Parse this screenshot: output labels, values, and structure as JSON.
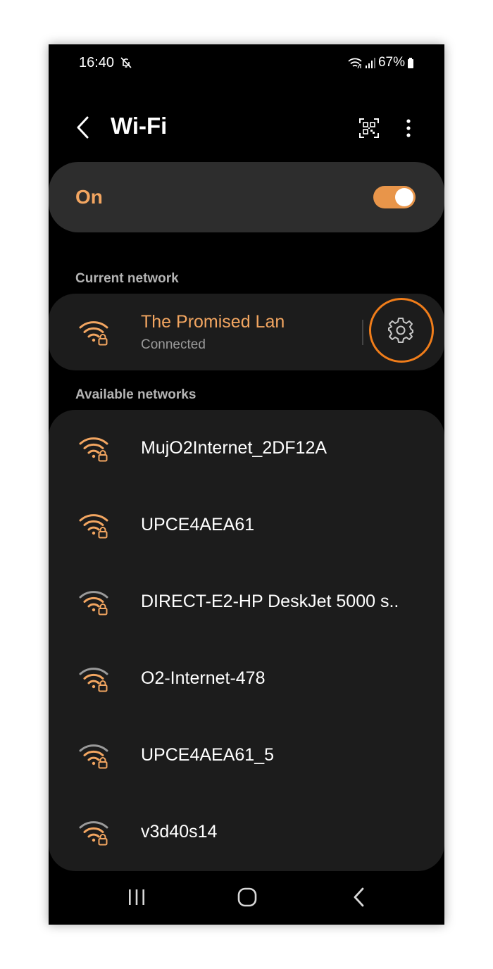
{
  "status_bar": {
    "time": "16:40",
    "battery": "67%"
  },
  "header": {
    "title": "Wi-Fi"
  },
  "wifi_toggle": {
    "label": "On",
    "state": true
  },
  "current": {
    "section_label": "Current network",
    "name": "The Promised Lan",
    "status": "Connected"
  },
  "available": {
    "section_label": "Available networks",
    "networks": [
      {
        "name": "MujO2Internet_2DF12A",
        "signal": "strong"
      },
      {
        "name": "UPCE4AEA61",
        "signal": "strong"
      },
      {
        "name": "DIRECT-E2-HP DeskJet 5000 s..",
        "signal": "weak"
      },
      {
        "name": "O2-Internet-478",
        "signal": "weak"
      },
      {
        "name": "UPCE4AEA61_5",
        "signal": "weak"
      },
      {
        "name": "v3d40s14",
        "signal": "weak"
      }
    ]
  },
  "colors": {
    "accent": "#f3a661",
    "switch": "#e8954a",
    "highlight": "#f07d1a",
    "card": "#1c1c1c"
  },
  "icons": [
    "dnd-icon",
    "wifi-status-icon",
    "signal-icon",
    "battery-icon",
    "back-icon",
    "qr-scan-icon",
    "more-vert-icon",
    "wifi-lock-icon",
    "gear-icon",
    "recents-icon",
    "home-icon",
    "nav-back-icon"
  ]
}
